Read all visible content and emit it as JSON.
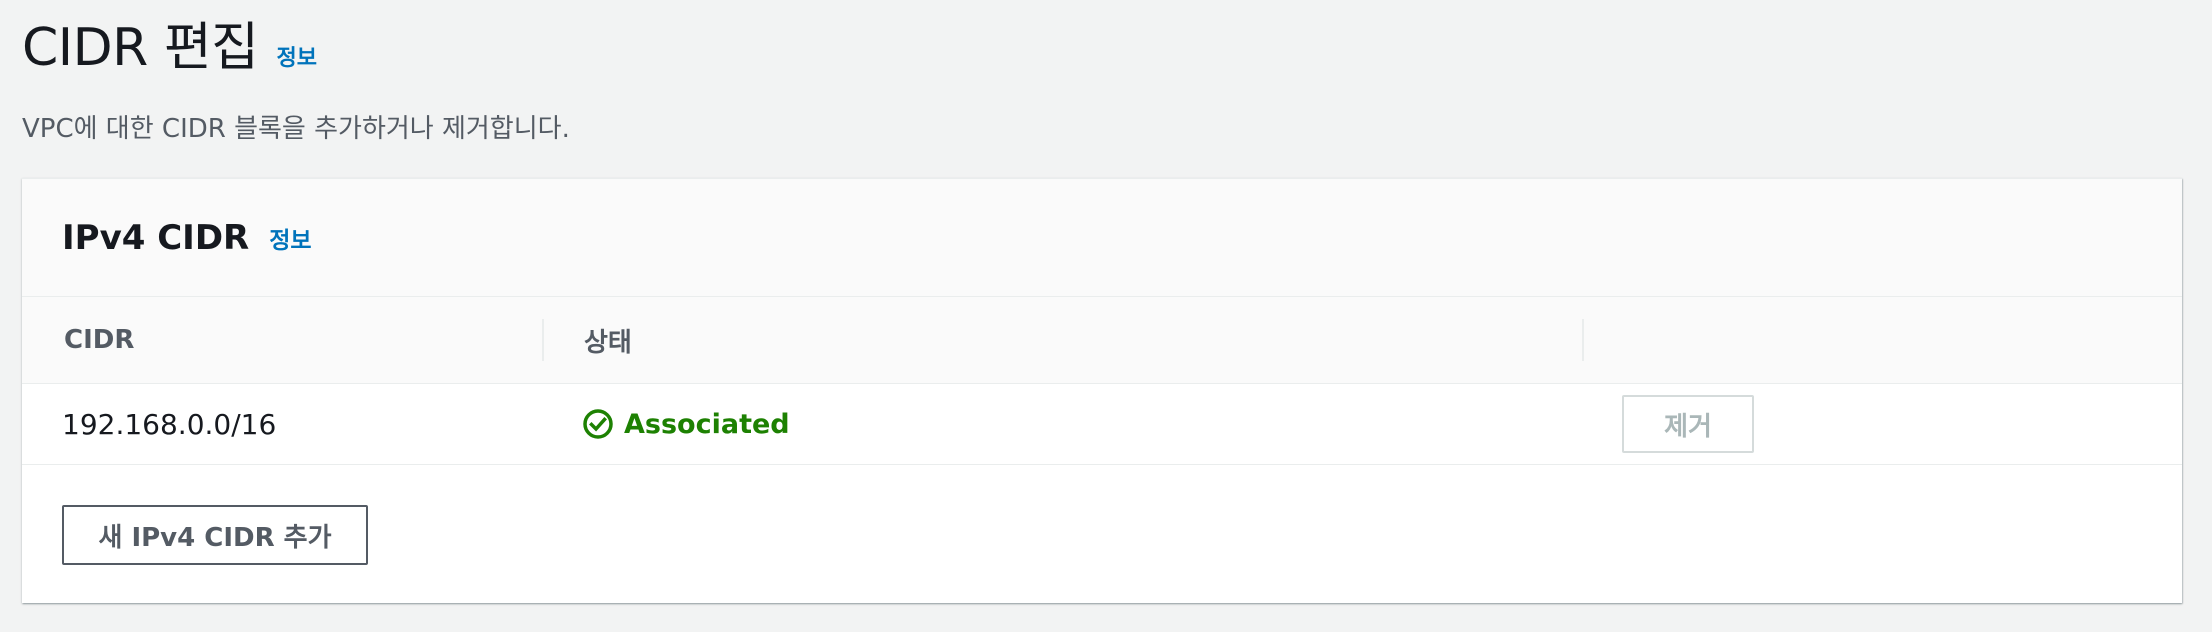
{
  "page": {
    "title": "CIDR 편집",
    "info_label": "정보",
    "description": "VPC에 대한 CIDR 블록을 추가하거나 제거합니다."
  },
  "panel": {
    "title": "IPv4 CIDR",
    "info_label": "정보",
    "table": {
      "columns": [
        "CIDR",
        "상태",
        ""
      ],
      "rows": [
        {
          "cidr": "192.168.0.0/16",
          "status": "Associated",
          "status_icon": "check-circle-icon",
          "action_label": "제거",
          "action_disabled": true
        }
      ]
    },
    "add_button_label": "새 IPv4 CIDR 추가"
  },
  "colors": {
    "background": "#f2f3f3",
    "link": "#0073bb",
    "status_success": "#1d8102",
    "disabled_text": "#aab7b8",
    "secondary_text": "#545b64"
  }
}
